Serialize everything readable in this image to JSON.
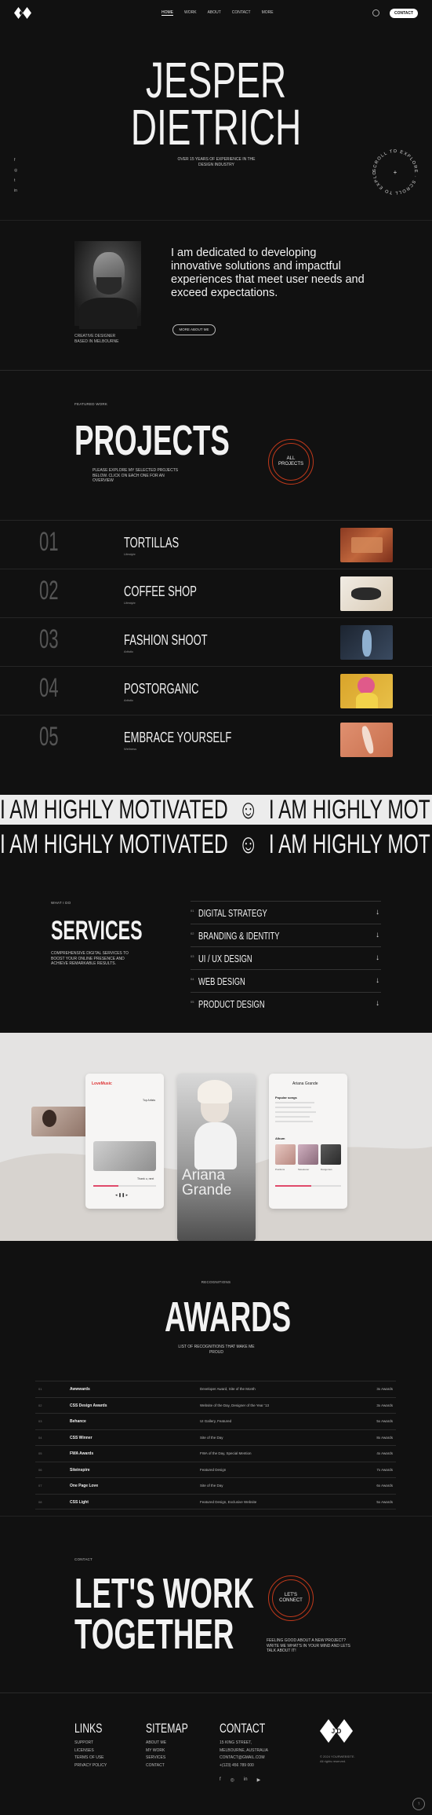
{
  "header": {
    "nav": [
      {
        "label": "HOME",
        "active": true
      },
      {
        "label": "WORK"
      },
      {
        "label": "ABOUT"
      },
      {
        "label": "CONTACT"
      },
      {
        "label": "MORE"
      }
    ],
    "contact_label": "CONTACT"
  },
  "hero": {
    "name_line1": "JESPER",
    "name_line2": "DIETRICH",
    "subtitle": "OVER 15 YEARS OF EXPERIENCE IN THE DESIGN INDUSTRY",
    "social": [
      "f",
      "◎",
      "t",
      "in"
    ],
    "scroll_text": "SCROLL TO EXPLORE · SCROLL TO EXPLORE ·"
  },
  "about": {
    "text": "I am dedicated to developing innovative solutions and impactful experiences that meet user needs and exceed expectations.",
    "caption_line1": "CREATIVE DESIGNER",
    "caption_line2": "BASED IN MELBOURNE",
    "button": "MORE ABOUT ME"
  },
  "projects": {
    "eyebrow": "FEATURED WORK",
    "title": "PROJECTS",
    "description": "PLEASE EXPLORE MY SELECTED PROJECTS BELOW. CLICK ON EACH ONE FOR AN OVERVIEW",
    "all_line1": "ALL",
    "all_line2": "PROJECTS",
    "items": [
      {
        "num": "01",
        "title": "TORTILLAS",
        "category": "Lifestyle"
      },
      {
        "num": "02",
        "title": "COFFEE SHOP",
        "category": "Lifestyle"
      },
      {
        "num": "03",
        "title": "FASHION SHOOT",
        "category": "Artistic"
      },
      {
        "num": "04",
        "title": "POSTORGANIC",
        "category": "Artistic"
      },
      {
        "num": "05",
        "title": "EMBRACE YOURSELF",
        "category": "Wellness"
      }
    ]
  },
  "marquee": {
    "text": "I AM HIGHLY MOTIVATED",
    "emoji": "☺"
  },
  "services": {
    "eyebrow": "WHAT I DO",
    "title": "SERVICES",
    "description": "COMPREHENSIVE DIGITAL SERVICES TO BOOST YOUR ONLINE PRESENCE AND ACHIEVE REMARKABLE RESULTS.",
    "items": [
      {
        "num": "01",
        "label": "DIGITAL STRATEGY"
      },
      {
        "num": "02",
        "label": "BRANDING & IDENTITY"
      },
      {
        "num": "03",
        "label": "UI / UX DESIGN"
      },
      {
        "num": "04",
        "label": "WEB DESIGN"
      },
      {
        "num": "05",
        "label": "PRODUCT DESIGN"
      }
    ]
  },
  "showcase": {
    "app_name": "LoveMusic",
    "tab1": "Top Artists",
    "artist_big1": "Ariana",
    "artist_big2": "Grande",
    "artist_small": "Ariana Grande",
    "popular": "Popular songs",
    "album": "Album",
    "track": "Thank u, next",
    "album_items": [
      "Positions",
      "Sweetener",
      "Dangerous"
    ]
  },
  "awards": {
    "eyebrow": "RECOGNITIONS",
    "title": "AWARDS",
    "subtitle": "LIST OF RECOGNITIONS THAT MAKE ME PROUD",
    "rows": [
      {
        "n": "01",
        "a": "Awwwards",
        "b": "Developer Award, Site of the Month",
        "c": "3x Awards"
      },
      {
        "n": "02",
        "a": "CSS Design Awards",
        "b": "Website of the Day, Designer of the Year '13",
        "c": "3x Awards"
      },
      {
        "n": "03",
        "a": "Behance",
        "b": "UI Gallery, Featured",
        "c": "5x Awards"
      },
      {
        "n": "04",
        "a": "CSS Winner",
        "b": "Site of the Day",
        "c": "8x Awards"
      },
      {
        "n": "05",
        "a": "FWA Awards",
        "b": "FWA of the Day, Special Mention",
        "c": "4x Awards"
      },
      {
        "n": "06",
        "a": "Siteinspire",
        "b": "Featured Design",
        "c": "7x Awards"
      },
      {
        "n": "07",
        "a": "One Page Love",
        "b": "Site of the Day",
        "c": "6x Awards"
      },
      {
        "n": "08",
        "a": "CSS Light",
        "b": "Featured Design, Exclusive Website",
        "c": "5x Awards"
      }
    ]
  },
  "contact": {
    "eyebrow": "CONTACT",
    "line1": "LET'S WORK",
    "line2": "TOGETHER",
    "circle_line1": "LET'S",
    "circle_line2": "CONNECT",
    "description": "FEELING GOOD ABOUT A NEW PROJECT? WRITE ME WHAT'S IN YOUR MIND AND LETS TALK ABOUT IT!"
  },
  "footer": {
    "links_title": "LINKS",
    "links": [
      "SUPPORT",
      "LICENSES",
      "TERMS OF USE",
      "PRIVACY POLICY"
    ],
    "sitemap_title": "SITEMAP",
    "sitemap": [
      "ABOUT ME",
      "MY WORK",
      "SERVICES",
      "CONTACT"
    ],
    "contact_title": "CONTACT",
    "contact": [
      "15 KING STREET,",
      "MELBOURNE, AUSTRALIA",
      "CONTACT@GMAIL.COM",
      "+(123) 456 789 000"
    ],
    "logo": "J D",
    "copy1": "© 2024 YOURWEBSITE.",
    "copy2": "All rights reserved.",
    "social": [
      "f",
      "◎",
      "in",
      "▶"
    ],
    "to_top": "↑"
  }
}
